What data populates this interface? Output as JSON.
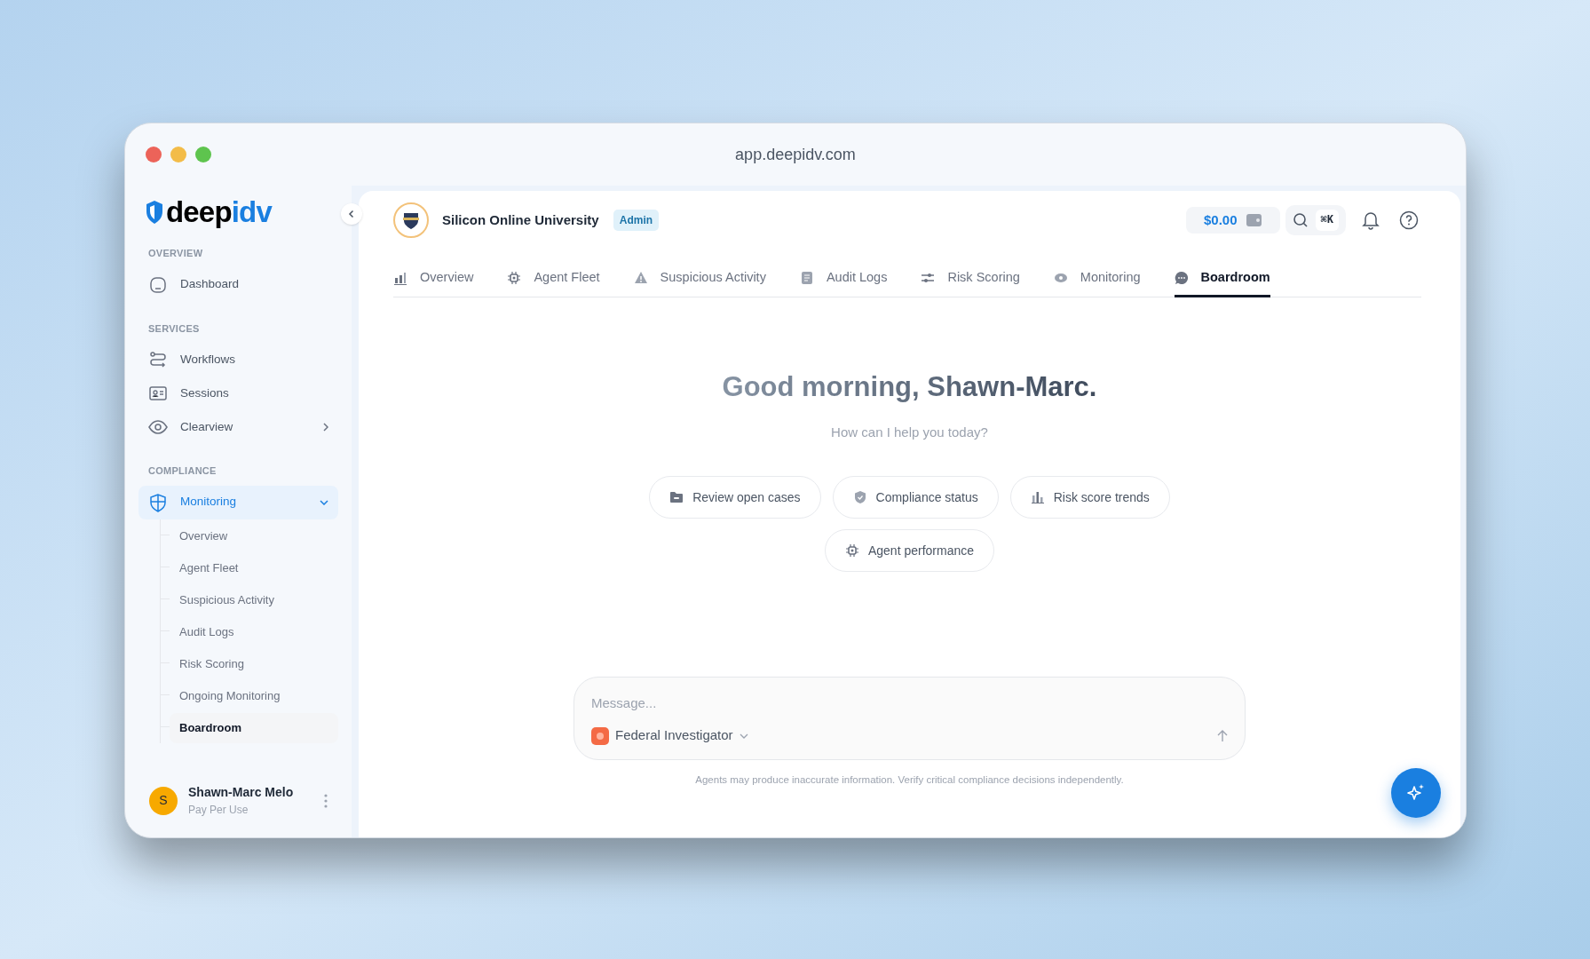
{
  "window": {
    "address": "app.deepidv.com"
  },
  "sidebar": {
    "logo": [
      "deep",
      "idv"
    ],
    "sections": [
      {
        "heading": "OVERVIEW",
        "items": [
          {
            "label": "Dashboard",
            "selected": false
          }
        ]
      },
      {
        "heading": "SERVICES",
        "items": [
          {
            "label": "Workflows",
            "selected": false
          },
          {
            "label": "Sessions",
            "selected": false
          },
          {
            "label": "Clearview",
            "selected": false,
            "expanded": false
          }
        ]
      },
      {
        "heading": "COMPLIANCE",
        "items": [
          {
            "label": "Monitoring",
            "selected": true,
            "expanded": true,
            "children": [
              {
                "label": "Overview",
                "selected": false
              },
              {
                "label": "Agent Fleet",
                "selected": false
              },
              {
                "label": "Suspicious Activity",
                "selected": false
              },
              {
                "label": "Audit Logs",
                "selected": false
              },
              {
                "label": "Risk Scoring",
                "selected": false
              },
              {
                "label": "Ongoing Monitoring",
                "selected": false
              },
              {
                "label": "Boardroom",
                "selected": true
              }
            ]
          }
        ]
      }
    ],
    "user": {
      "initial": "S",
      "name": "Shawn-Marc Melo",
      "plan": "Pay Per Use"
    }
  },
  "header": {
    "org": "Silicon Online University",
    "badge": "Admin",
    "balance": "$0.00",
    "shortcut": "⌘K"
  },
  "tabs": [
    {
      "label": "Overview",
      "selected": false
    },
    {
      "label": "Agent Fleet",
      "selected": false
    },
    {
      "label": "Suspicious Activity",
      "selected": false
    },
    {
      "label": "Audit Logs",
      "selected": false
    },
    {
      "label": "Risk Scoring",
      "selected": false
    },
    {
      "label": "Monitoring",
      "selected": false
    },
    {
      "label": "Boardroom",
      "selected": true
    }
  ],
  "greeting": {
    "title": "Good morning, Shawn-Marc.",
    "subtitle": "How can I help you today?"
  },
  "suggestions": [
    "Review open cases",
    "Compliance status",
    "Risk score trends",
    "Agent performance"
  ],
  "composer": {
    "placeholder": "Message...",
    "agent": "Federal Investigator",
    "disclaimer": "Agents may produce inaccurate information. Verify critical compliance decisions independently."
  }
}
